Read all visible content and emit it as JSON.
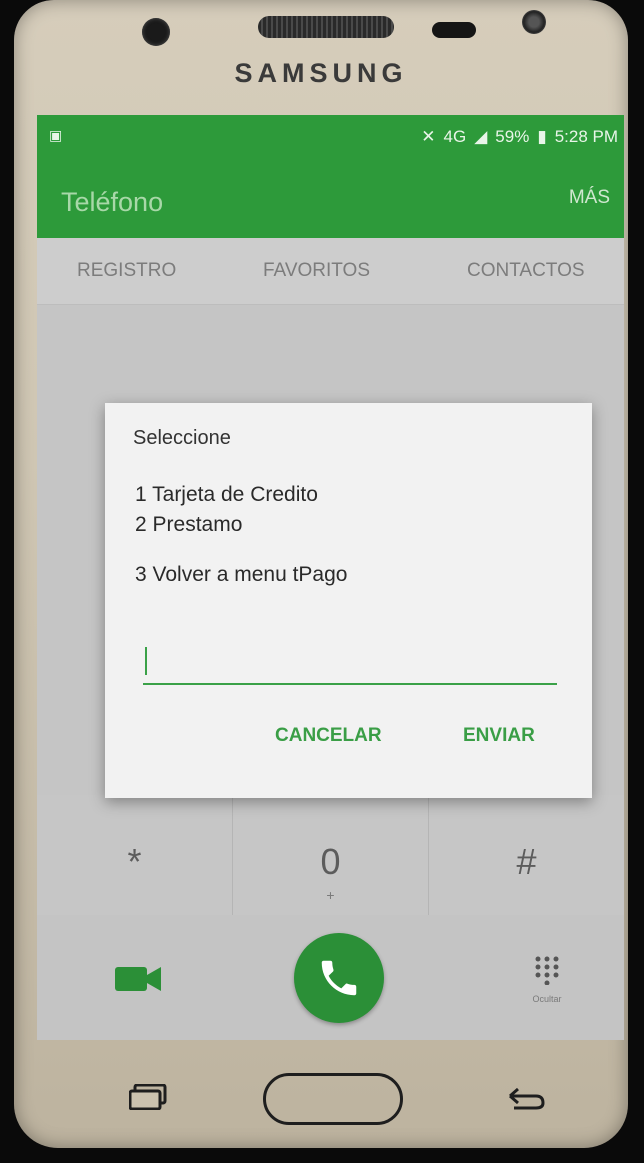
{
  "device": {
    "brand": "SAMSUNG"
  },
  "status_bar": {
    "signal_text": "4G",
    "battery": "59%",
    "time": "5:28 PM"
  },
  "app_bar": {
    "title": "Teléfono",
    "more": "MÁS"
  },
  "tabs": [
    {
      "label": "REGISTRO"
    },
    {
      "label": "FAVORITOS"
    },
    {
      "label": "CONTACTOS"
    }
  ],
  "dialog": {
    "title": "Seleccione",
    "lines": [
      "1 Tarjeta de Credito",
      "2 Prestamo",
      "3 Volver a menu tPago"
    ],
    "input_value": "",
    "cancel_label": "CANCELAR",
    "send_label": "ENVIAR"
  },
  "keypad": {
    "keys": [
      {
        "digit": "*",
        "sub": ""
      },
      {
        "digit": "0",
        "sub": "+"
      },
      {
        "digit": "#",
        "sub": ""
      }
    ]
  },
  "bottom": {
    "hide_label": "Ocultar"
  },
  "colors": {
    "accent": "#2d9a3a",
    "button_text": "#3a9e46"
  },
  "icons": [
    "video-call-icon",
    "phone-icon",
    "dialpad-icon",
    "recents-icon",
    "back-icon"
  ]
}
